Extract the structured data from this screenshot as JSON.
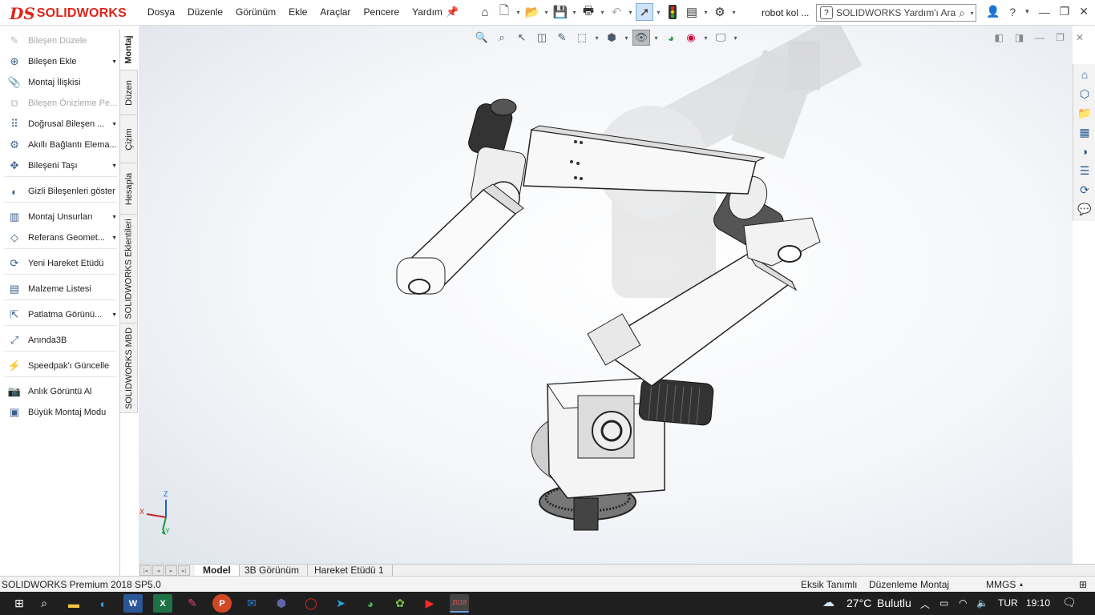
{
  "app": {
    "brand_mark": "DS",
    "brand_name": "SOLIDWORKS"
  },
  "menu": [
    "Dosya",
    "Düzenle",
    "Görünüm",
    "Ekle",
    "Araçlar",
    "Pencere",
    "Yardım"
  ],
  "document_title": "robot kol ...",
  "search": {
    "placeholder": "SOLIDWORKS Yardım'ı Ara"
  },
  "commands": [
    {
      "label": "Bileşen Düzele",
      "icon": "edit-component-icon",
      "enabled": false
    },
    {
      "label": "Bileşen Ekle",
      "icon": "insert-component-icon",
      "enabled": true,
      "dropdown": true
    },
    {
      "label": "Montaj İlişkisi",
      "icon": "mate-icon",
      "enabled": true
    },
    {
      "label": "Bileşen Önizleme Pe...",
      "icon": "component-preview-icon",
      "enabled": false
    },
    {
      "label": "Doğrusal Bileşen ...",
      "icon": "linear-pattern-icon",
      "enabled": true,
      "dropdown": true
    },
    {
      "label": "Akıllı Bağlantı Elema...",
      "icon": "smart-fasteners-icon",
      "enabled": true
    },
    {
      "label": "Bileşeni Taşı",
      "icon": "move-component-icon",
      "enabled": true,
      "dropdown": true
    },
    {
      "label": "Gizli Bileşenleri göster",
      "icon": "show-hidden-icon",
      "enabled": true
    },
    {
      "label": "Montaj Unsurları",
      "icon": "assembly-features-icon",
      "enabled": true,
      "dropdown": true
    },
    {
      "label": "Referans Geomet...",
      "icon": "reference-geometry-icon",
      "enabled": true,
      "dropdown": true
    },
    {
      "label": "Yeni Hareket Etüdü",
      "icon": "motion-study-icon",
      "enabled": true
    },
    {
      "label": "Malzeme Listesi",
      "icon": "bill-of-materials-icon",
      "enabled": true
    },
    {
      "label": "Patlatma Görünü...",
      "icon": "exploded-view-icon",
      "enabled": true,
      "dropdown": true
    },
    {
      "label": "Anında3B",
      "icon": "instant3d-icon",
      "enabled": true
    },
    {
      "label": "Speedpak'ı Güncelle",
      "icon": "speedpak-icon",
      "enabled": true
    },
    {
      "label": "Anlık Görüntü Al",
      "icon": "snapshot-icon",
      "enabled": true
    },
    {
      "label": "Büyük Montaj Modu",
      "icon": "large-assembly-icon",
      "enabled": true
    }
  ],
  "vertical_tabs": [
    "Montaj",
    "Düzen",
    "Çizim",
    "Hesapla",
    "SOLIDWORKS Eklentileri",
    "SOLIDWORKS MBD"
  ],
  "triad": {
    "x": "X",
    "y": "Y",
    "z": "Z"
  },
  "bottom_tabs": [
    "Model",
    "3B Görünüm",
    "Hareket Etüdü 1"
  ],
  "status": {
    "product": "SOLIDWORKS Premium 2018 SP5.0",
    "definition": "Eksik Tanımlı",
    "mode": "Düzenleme Montaj",
    "units": "MMGS"
  },
  "taskbar": {
    "sw_badge": "2018",
    "temperature": "27°C",
    "weather": "Bulutlu",
    "language": "TUR",
    "time": "19:10"
  }
}
